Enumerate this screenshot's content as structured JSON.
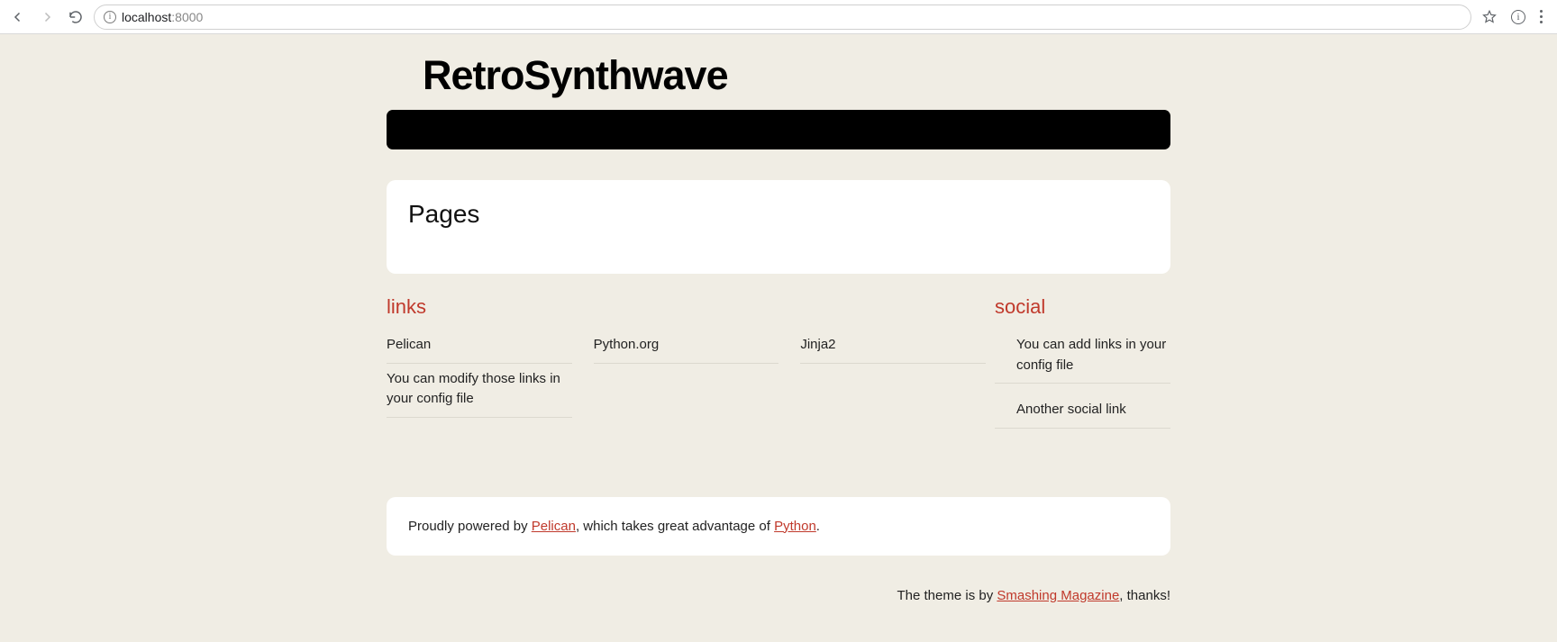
{
  "browser": {
    "url_host": "localhost",
    "url_port": ":8000"
  },
  "site": {
    "title": "RetroSynthwave"
  },
  "pages": {
    "heading": "Pages"
  },
  "links_section": {
    "title": "links",
    "items": [
      "Pelican",
      "Python.org",
      "Jinja2",
      "You can modify those links in your config file"
    ]
  },
  "social_section": {
    "title": "social",
    "items": [
      "You can add links in your config file",
      "Another social link"
    ]
  },
  "footer": {
    "pre1": "Proudly powered by ",
    "link1": "Pelican",
    "mid1": ", which takes great advantage of ",
    "link2": "Python",
    "post1": "."
  },
  "theme_credit": {
    "pre": "The theme is by ",
    "link": "Smashing Magazine",
    "post": ", thanks!"
  }
}
